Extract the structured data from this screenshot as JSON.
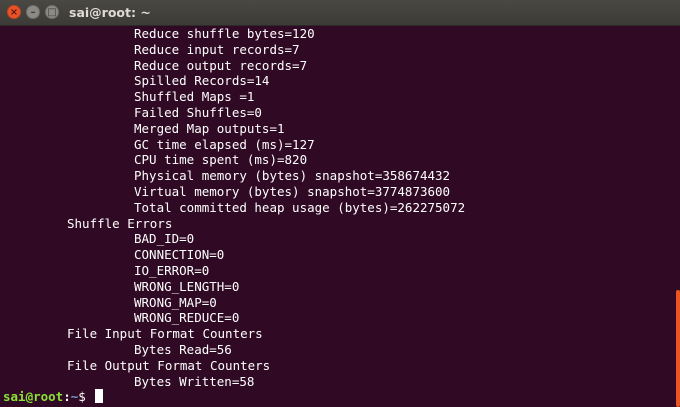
{
  "window": {
    "title": "sai@root: ~",
    "close_glyph": "×",
    "minimize_glyph": "–",
    "maximize_glyph": "□"
  },
  "terminal": {
    "lines": [
      {
        "indent": 2,
        "text": "Reduce shuffle bytes=120"
      },
      {
        "indent": 2,
        "text": "Reduce input records=7"
      },
      {
        "indent": 2,
        "text": "Reduce output records=7"
      },
      {
        "indent": 2,
        "text": "Spilled Records=14"
      },
      {
        "indent": 2,
        "text": "Shuffled Maps =1"
      },
      {
        "indent": 2,
        "text": "Failed Shuffles=0"
      },
      {
        "indent": 2,
        "text": "Merged Map outputs=1"
      },
      {
        "indent": 2,
        "text": "GC time elapsed (ms)=127"
      },
      {
        "indent": 2,
        "text": "CPU time spent (ms)=820"
      },
      {
        "indent": 2,
        "text": "Physical memory (bytes) snapshot=358674432"
      },
      {
        "indent": 2,
        "text": "Virtual memory (bytes) snapshot=3774873600"
      },
      {
        "indent": 2,
        "text": "Total committed heap usage (bytes)=262275072"
      },
      {
        "indent": 1,
        "text": "Shuffle Errors"
      },
      {
        "indent": 2,
        "text": "BAD_ID=0"
      },
      {
        "indent": 2,
        "text": "CONNECTION=0"
      },
      {
        "indent": 2,
        "text": "IO_ERROR=0"
      },
      {
        "indent": 2,
        "text": "WRONG_LENGTH=0"
      },
      {
        "indent": 2,
        "text": "WRONG_MAP=0"
      },
      {
        "indent": 2,
        "text": "WRONG_REDUCE=0"
      },
      {
        "indent": 1,
        "text": "File Input Format Counters"
      },
      {
        "indent": 2,
        "text": "Bytes Read=56"
      },
      {
        "indent": 1,
        "text": "File Output Format Counters"
      },
      {
        "indent": 2,
        "text": "Bytes Written=58"
      }
    ],
    "prompt": {
      "user_host": "sai@root",
      "separator": ":",
      "path": "~",
      "symbol": "$ "
    }
  },
  "colors": {
    "background": "#300a24",
    "text": "#ffffff",
    "prompt_user": "#8ae234",
    "prompt_path": "#729fcf",
    "scrollbar": "#e95420"
  }
}
